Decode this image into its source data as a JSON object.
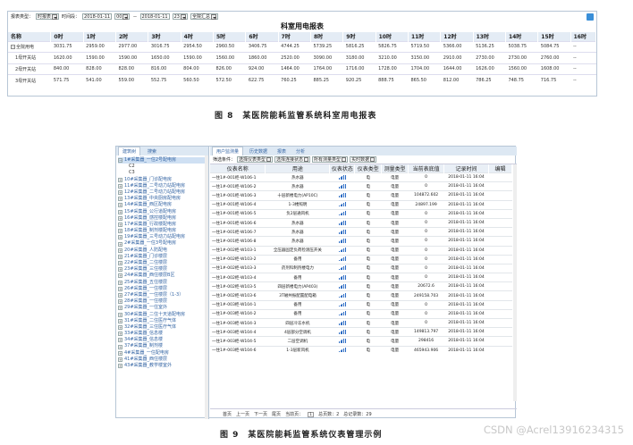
{
  "fig8": {
    "filter": {
      "report_type_label": "报表类型：",
      "report_type_value": "时报表",
      "period_label": "时间段：",
      "start_date": "2018-01-11",
      "start_hour": "00",
      "dash": "－",
      "end_date": "2018-01-11",
      "end_hour": "23",
      "scope": "全院汇总"
    },
    "title": "科室用电报表",
    "columns": [
      "名称",
      "0时",
      "1时",
      "2时",
      "3时",
      "4时",
      "5时",
      "6时",
      "7时",
      "8时",
      "9时",
      "10时",
      "11时",
      "12时",
      "13时",
      "14时",
      "15时",
      "16时"
    ],
    "rows": [
      {
        "name": "全院用电",
        "total": true,
        "values": [
          "3031.75",
          "2959.00",
          "2977.00",
          "3016.75",
          "2954.50",
          "2960.50",
          "3406.75",
          "4744.25",
          "5739.25",
          "5816.25",
          "5826.75",
          "5719.50",
          "5366.00",
          "5136.25",
          "5038.75",
          "5084.75",
          "--"
        ]
      },
      {
        "name": "1母开关站",
        "values": [
          "1620.00",
          "1590.00",
          "1590.00",
          "1650.00",
          "1590.00",
          "1560.00",
          "1860.00",
          "2520.00",
          "3090.00",
          "3180.00",
          "3210.00",
          "3150.00",
          "2910.00",
          "2730.00",
          "2730.00",
          "2760.00",
          "--"
        ]
      },
      {
        "name": "2母开关站",
        "values": [
          "840.00",
          "828.00",
          "828.00",
          "816.00",
          "804.00",
          "826.00",
          "924.00",
          "1464.00",
          "1764.00",
          "1716.00",
          "1728.00",
          "1704.00",
          "1644.00",
          "1626.00",
          "1560.00",
          "1608.00",
          "--"
        ]
      },
      {
        "name": "3母开关站",
        "values": [
          "571.75",
          "541.00",
          "559.00",
          "552.75",
          "560.50",
          "572.50",
          "622.75",
          "760.25",
          "885.25",
          "920.25",
          "888.75",
          "865.50",
          "812.00",
          "786.25",
          "748.75",
          "716.75",
          "--"
        ]
      }
    ],
    "caption": "图 8　某医院能耗监管系统科室用电报表"
  },
  "fig9": {
    "sidebar_tabs": [
      "建筑树",
      "搜索"
    ],
    "tree": [
      {
        "label": "1#采集器_一住2号配电房",
        "selected": true
      },
      {
        "label": "C2",
        "sub": true
      },
      {
        "label": "C3",
        "sub": true
      },
      {
        "label": "10#采集器_门诊配电房"
      },
      {
        "label": "11#采集器_二号动力站配电房"
      },
      {
        "label": "12#采集器_二号动力站配电房"
      },
      {
        "label": "13#采集器_中央厨房配电房"
      },
      {
        "label": "14#采集器_西区配电房"
      },
      {
        "label": "15#采集器_公行道配电房"
      },
      {
        "label": "16#采集器_感控楼配电房"
      },
      {
        "label": "17#采集器_行政楼配电房"
      },
      {
        "label": "18#采集器_制剂楼配电房"
      },
      {
        "label": "19#采集器_三号动力站配电房"
      },
      {
        "label": "2#采集器_一住3号配电房"
      },
      {
        "label": "20#采集器_人防配电"
      },
      {
        "label": "21#采集器_门诊楼层"
      },
      {
        "label": "22#采集器_二住楼层"
      },
      {
        "label": "23#采集器_三住楼层"
      },
      {
        "label": "24#采集器_西住楼层B区"
      },
      {
        "label": "25#采集器_五住楼层"
      },
      {
        "label": "26#采集器_一住楼层"
      },
      {
        "label": "27#采集器_一住楼层（1-3）"
      },
      {
        "label": "28#采集器_一住楼层"
      },
      {
        "label": "29#采集器_一住室外"
      },
      {
        "label": "30#采集器_二住十天道配电房"
      },
      {
        "label": "31#采集器_二住医疗气体"
      },
      {
        "label": "32#采集器_三住医疗气体"
      },
      {
        "label": "33#采集器_信息楼"
      },
      {
        "label": "34#采集器_信息楼"
      },
      {
        "label": "37#采集器_制剂楼"
      },
      {
        "label": "4#采集器_一住配电房"
      },
      {
        "label": "41#采集器_西住楼层"
      },
      {
        "label": "43#采集器_教学楼室外"
      }
    ],
    "main_tabs": [
      "用户监测量",
      "历史数据",
      "报表",
      "分析"
    ],
    "filter": {
      "cond_label": "筛选条件：",
      "type_sel": "选择仪表类型",
      "status_sel": "选择连接状态",
      "param_sel": "所有测量类型",
      "time_sel": "实时数据"
    },
    "columns": [
      "仪表名称",
      "用途",
      "仪表状态",
      "仪表类型",
      "测量类型",
      "当前表底值",
      "记录时间",
      "编辑"
    ],
    "rows": [
      [
        "一住1#-001柜-W106-1",
        "热水器",
        "电",
        "电量",
        "0",
        "2018-01-11 16:04"
      ],
      [
        "一住1#-001柜-W106-2",
        "热水器",
        "电",
        "电量",
        "0",
        "2018-01-11 16:04"
      ],
      [
        "一住1#-001柜-W106-3",
        "十层新楼电力(AP10C)",
        "电",
        "电量",
        "104872.602",
        "2018-01-11 16:04"
      ],
      [
        "一住1#-001柜-W106-4",
        "1-3楼照明",
        "电",
        "电量",
        "24897.199",
        "2018-01-11 16:04"
      ],
      [
        "一住1#-001柜-W106-5",
        "负2层通风机",
        "电",
        "电量",
        "0",
        "2018-01-11 16:04"
      ],
      [
        "一住1#-001柜-W106-6",
        "热水器",
        "电",
        "电量",
        "0",
        "2018-01-11 16:04"
      ],
      [
        "一住1#-001柜-W106-7",
        "热水器",
        "电",
        "电量",
        "0",
        "2018-01-11 16:04"
      ],
      [
        "一住1#-001柜-W106-8",
        "热水器",
        "电",
        "电量",
        "0",
        "2018-01-11 16:04"
      ],
      [
        "一住1#-002柜-W103-1",
        "全压器固定负荷检测压开关",
        "电",
        "电量",
        "0",
        "2018-01-11 16:04"
      ],
      [
        "一住1#-002柜-W103-2",
        "备用",
        "电",
        "电量",
        "0",
        "2018-01-11 16:04"
      ],
      [
        "一住1#-002柜-W103-3",
        "药剂科制剂楼电力",
        "电",
        "电量",
        "0",
        "2018-01-11 16:04"
      ],
      [
        "一住1#-002柜-W103-4",
        "备用",
        "电",
        "电量",
        "0",
        "2018-01-11 16:04"
      ],
      [
        "一住1#-002柜-W103-5",
        "四层新楼电力(AP403)",
        "电",
        "电量",
        "20672.6",
        "2018-01-11 16:04"
      ],
      [
        "一住1#-002柜-W103-6",
        "3T磁共振配置配电箱",
        "电",
        "电量",
        "249158.703",
        "2018-01-11 16:04"
      ],
      [
        "一住1#-003柜-W104-1",
        "备用",
        "电",
        "电量",
        "0",
        "2018-01-11 16:04"
      ],
      [
        "一住1#-003柜-W104-2",
        "备用",
        "电",
        "电量",
        "0",
        "2018-01-11 16:04"
      ],
      [
        "一住1#-003柜-W104-3",
        "四层冷冻水机",
        "电",
        "电量",
        "0",
        "2018-01-11 16:04"
      ],
      [
        "一住1#-003柜-W104-4",
        "4层部分空调机",
        "电",
        "电量",
        "149813.797",
        "2018-01-11 16:04"
      ],
      [
        "一住1#-003柜-W104-5",
        "二层空调机",
        "电",
        "电量",
        "298416",
        "2018-01-11 16:04"
      ],
      [
        "一住1#-003柜-W104-6",
        "1-3层新风机",
        "电",
        "电量",
        "465943.906",
        "2018-01-11 16:04"
      ]
    ],
    "pager": {
      "first": "首页",
      "prev": "上一页",
      "next": "下一页",
      "last": "尾页",
      "current_label": "当前页：",
      "current": "1",
      "total_label": "总页数：2",
      "records_label": "总记录数：29"
    },
    "caption": "图 9　某医院能耗监管系统仪表管理示例"
  },
  "watermark": "CSDN @Acrel13916234315",
  "colors": {
    "accent": "#3465a4",
    "header_bg": "#e4ecf5",
    "signal": "#2c6cc4"
  }
}
